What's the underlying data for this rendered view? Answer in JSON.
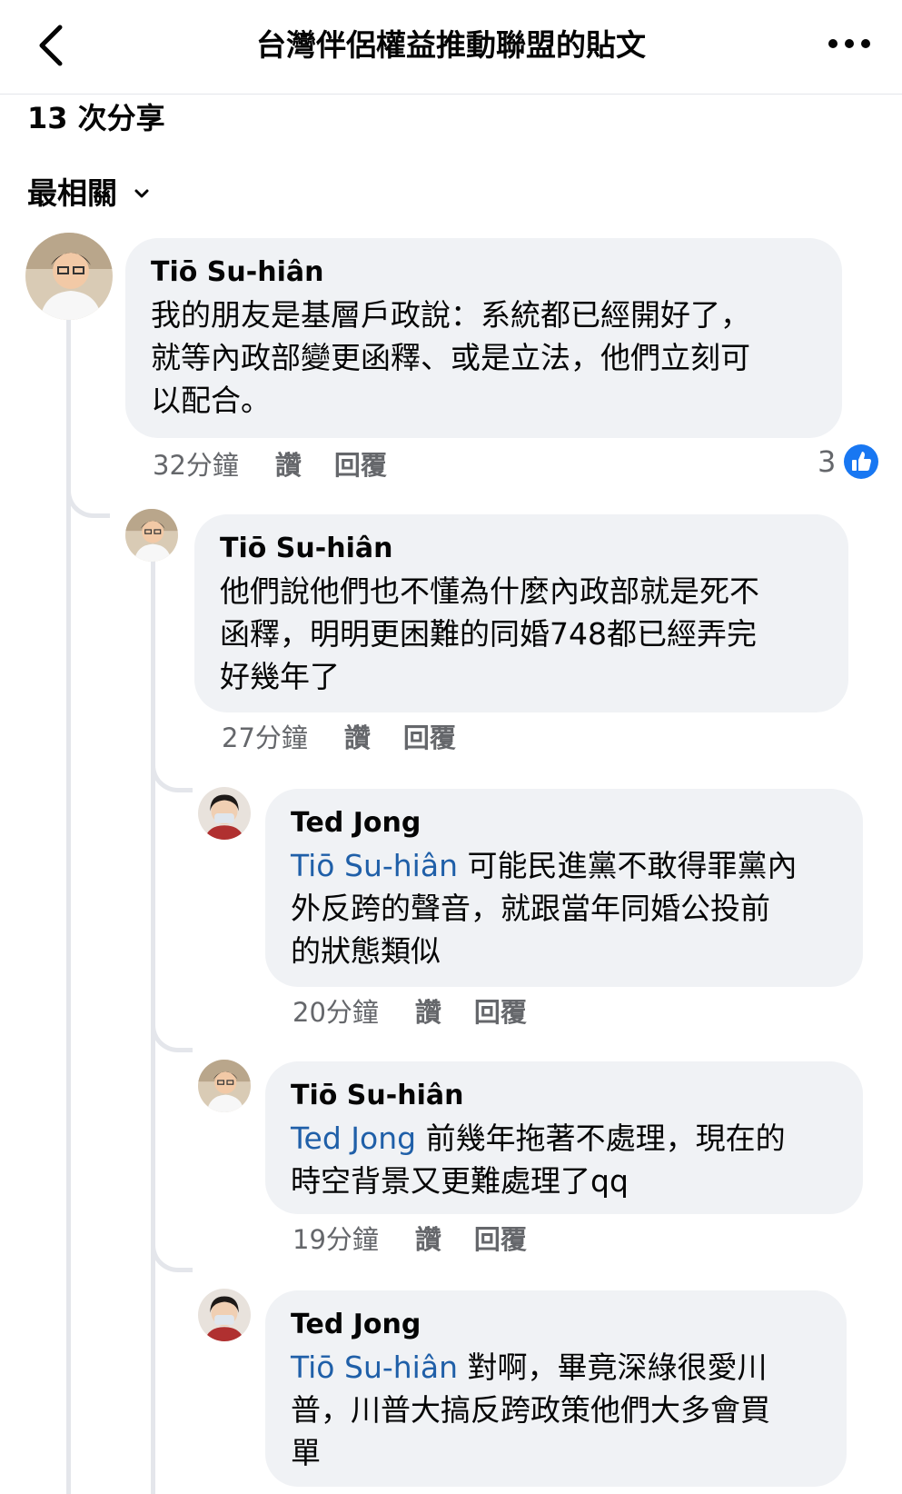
{
  "header": {
    "title": "台灣伴侶權益推動聯盟的貼文",
    "back_icon": "chevron-left-icon",
    "more_icon": "more-dots-icon"
  },
  "post_stats": {
    "shares": "13 次分享"
  },
  "sort": {
    "label": "最相關",
    "icon": "chevron-down-icon"
  },
  "colors": {
    "mention": "#1f5fa8",
    "bubble": "#f0f2f5",
    "meta": "#65676b",
    "like_blue": "#1877f2"
  },
  "comments": [
    {
      "author": "Tiō Su-hiân",
      "text": "我的朋友是基層戶政說：系統都已經開好了，就等內政部變更函釋、或是立法，他們立刻可以配合。",
      "lines": [
        "我的朋友是基層戶政說：系統都已經開好了，",
        "就等內政部變更函釋、或是立法，他們立刻可",
        "以配合。"
      ],
      "time": "32分鐘",
      "like_label": "讚",
      "reply_label": "回覆",
      "reaction_count": "3",
      "reaction_icon": "like-icon"
    },
    {
      "author": "Tiō Su-hiân",
      "text": "他們說他們也不懂為什麼內政部就是死不函釋，明明更困難的同婚748都已經弄完好幾年了",
      "lines": [
        "他們說他們也不懂為什麼內政部就是死不",
        "函釋，明明更困難的同婚748都已經弄完",
        "好幾年了"
      ],
      "time": "27分鐘",
      "like_label": "讚",
      "reply_label": "回覆"
    },
    {
      "author": "Ted Jong",
      "mention": "Tiō Su-hiân",
      "lines": [
        "可能民進黨不敢得罪黨內",
        "外反跨的聲音，就跟當年同婚公投前",
        "的狀態類似"
      ],
      "time": "20分鐘",
      "like_label": "讚",
      "reply_label": "回覆"
    },
    {
      "author": "Tiō Su-hiân",
      "mention": "Ted Jong",
      "lines": [
        "前幾年拖著不處理，現在的",
        "時空背景又更難處理了qq"
      ],
      "time": "19分鐘",
      "like_label": "讚",
      "reply_label": "回覆"
    },
    {
      "author": "Ted Jong",
      "mention": "Tiō Su-hiân",
      "lines": [
        "對啊，畢竟深綠很愛川",
        "普，川普大搞反跨政策他們大多會買",
        "單"
      ]
    }
  ]
}
